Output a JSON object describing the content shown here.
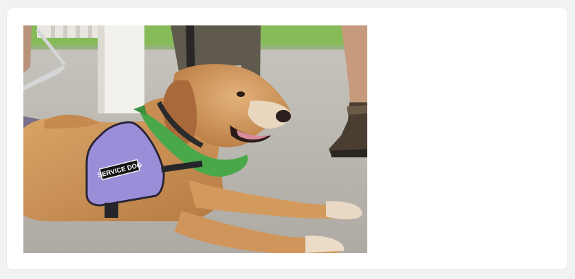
{
  "photo": {
    "subject": "service-dog",
    "vest_patch_text": "SERVICE DOG",
    "colors": {
      "page_background": "#f1f2f4",
      "card_background": "#ffffff",
      "vest": "#9b8ed8",
      "bandana": "#49a84a",
      "dog_fur": "#c98e52",
      "floor": "#b7b4ad",
      "grass": "#7fba52"
    }
  }
}
